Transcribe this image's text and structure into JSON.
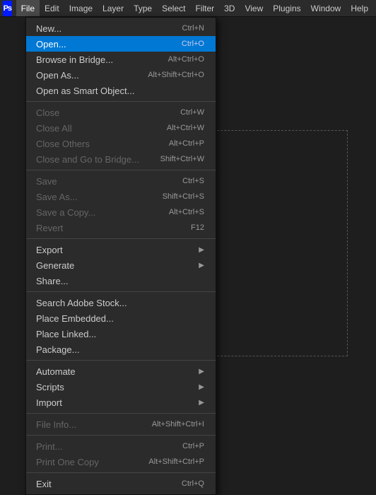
{
  "app": {
    "icon": "Ps",
    "icon_bg": "#001aff"
  },
  "menubar": {
    "items": [
      {
        "id": "file",
        "label": "File",
        "active": true
      },
      {
        "id": "edit",
        "label": "Edit"
      },
      {
        "id": "image",
        "label": "Image"
      },
      {
        "id": "layer",
        "label": "Layer"
      },
      {
        "id": "type",
        "label": "Type"
      },
      {
        "id": "select",
        "label": "Select"
      },
      {
        "id": "filter",
        "label": "Filter"
      },
      {
        "id": "3d",
        "label": "3D"
      },
      {
        "id": "view",
        "label": "View"
      },
      {
        "id": "plugins",
        "label": "Plugins"
      },
      {
        "id": "window",
        "label": "Window"
      },
      {
        "id": "help",
        "label": "Help"
      }
    ]
  },
  "dropdown": {
    "items": [
      {
        "id": "new",
        "label": "New...",
        "shortcut": "Ctrl+N",
        "disabled": false,
        "separator_after": false,
        "has_arrow": false
      },
      {
        "id": "open",
        "label": "Open...",
        "shortcut": "Ctrl+O",
        "disabled": false,
        "separator_after": false,
        "has_arrow": false,
        "active": true
      },
      {
        "id": "browse-bridge",
        "label": "Browse in Bridge...",
        "shortcut": "Alt+Ctrl+O",
        "disabled": false,
        "separator_after": false,
        "has_arrow": false
      },
      {
        "id": "open-as",
        "label": "Open As...",
        "shortcut": "Alt+Shift+Ctrl+O",
        "disabled": false,
        "separator_after": false,
        "has_arrow": false
      },
      {
        "id": "open-smart",
        "label": "Open as Smart Object...",
        "shortcut": "",
        "disabled": false,
        "separator_after": true,
        "has_arrow": false
      },
      {
        "id": "close",
        "label": "Close",
        "shortcut": "Ctrl+W",
        "disabled": true,
        "separator_after": false,
        "has_arrow": false
      },
      {
        "id": "close-all",
        "label": "Close All",
        "shortcut": "Alt+Ctrl+W",
        "disabled": true,
        "separator_after": false,
        "has_arrow": false
      },
      {
        "id": "close-others",
        "label": "Close Others",
        "shortcut": "Alt+Ctrl+P",
        "disabled": true,
        "separator_after": false,
        "has_arrow": false
      },
      {
        "id": "close-go-bridge",
        "label": "Close and Go to Bridge...",
        "shortcut": "Shift+Ctrl+W",
        "disabled": true,
        "separator_after": true,
        "has_arrow": false
      },
      {
        "id": "save",
        "label": "Save",
        "shortcut": "Ctrl+S",
        "disabled": true,
        "separator_after": false,
        "has_arrow": false
      },
      {
        "id": "save-as",
        "label": "Save As...",
        "shortcut": "Shift+Ctrl+S",
        "disabled": true,
        "separator_after": false,
        "has_arrow": false
      },
      {
        "id": "save-copy",
        "label": "Save a Copy...",
        "shortcut": "Alt+Ctrl+S",
        "disabled": true,
        "separator_after": false,
        "has_arrow": false
      },
      {
        "id": "revert",
        "label": "Revert",
        "shortcut": "F12",
        "disabled": true,
        "separator_after": true,
        "has_arrow": false
      },
      {
        "id": "export",
        "label": "Export",
        "shortcut": "",
        "disabled": false,
        "separator_after": false,
        "has_arrow": true
      },
      {
        "id": "generate",
        "label": "Generate",
        "shortcut": "",
        "disabled": false,
        "separator_after": false,
        "has_arrow": true
      },
      {
        "id": "share",
        "label": "Share...",
        "shortcut": "",
        "disabled": false,
        "separator_after": true,
        "has_arrow": false
      },
      {
        "id": "search-adobe-stock",
        "label": "Search Adobe Stock...",
        "shortcut": "",
        "disabled": false,
        "separator_after": false,
        "has_arrow": false
      },
      {
        "id": "place-embedded",
        "label": "Place Embedded...",
        "shortcut": "",
        "disabled": false,
        "separator_after": false,
        "has_arrow": false
      },
      {
        "id": "place-linked",
        "label": "Place Linked...",
        "shortcut": "",
        "disabled": false,
        "separator_after": false,
        "has_arrow": false
      },
      {
        "id": "package",
        "label": "Package...",
        "shortcut": "",
        "disabled": false,
        "separator_after": true,
        "has_arrow": false
      },
      {
        "id": "automate",
        "label": "Automate",
        "shortcut": "",
        "disabled": false,
        "separator_after": false,
        "has_arrow": true
      },
      {
        "id": "scripts",
        "label": "Scripts",
        "shortcut": "",
        "disabled": false,
        "separator_after": false,
        "has_arrow": true
      },
      {
        "id": "import",
        "label": "Import",
        "shortcut": "",
        "disabled": false,
        "separator_after": true,
        "has_arrow": true
      },
      {
        "id": "file-info",
        "label": "File Info...",
        "shortcut": "Alt+Shift+Ctrl+I",
        "disabled": true,
        "separator_after": true,
        "has_arrow": false
      },
      {
        "id": "print",
        "label": "Print...",
        "shortcut": "Ctrl+P",
        "disabled": true,
        "separator_after": false,
        "has_arrow": false
      },
      {
        "id": "print-one-copy",
        "label": "Print One Copy",
        "shortcut": "Alt+Shift+Ctrl+P",
        "disabled": true,
        "separator_after": true,
        "has_arrow": false
      },
      {
        "id": "exit",
        "label": "Exit",
        "shortcut": "Ctrl+Q",
        "disabled": false,
        "separator_after": false,
        "has_arrow": false
      }
    ]
  }
}
